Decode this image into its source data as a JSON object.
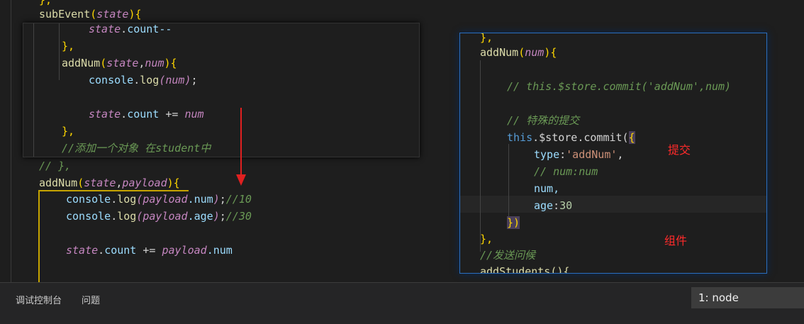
{
  "main_code": {
    "line_top": "},",
    "sub_event_name": "subEvent",
    "sub_event_param": "state",
    "line_close_comment": "// },",
    "add_num_name": "addNum",
    "add_num_params_state": "state",
    "add_num_params_payload": "payload",
    "log_payload_num": ".num",
    "log_comment_10": "//10",
    "log_payload_age": ".age",
    "log_comment_30": "//30",
    "state_count": "count",
    "payload_num": ".num"
  },
  "overlay_left": {
    "line1": "state.count--",
    "line2": "},",
    "line3_name": "addNum",
    "line3_params_state": "state",
    "line3_params_num": "num",
    "line4": "console.log(num);",
    "line5": "state.count += num",
    "line6": "},",
    "line7": "//添加一个对象 在student中"
  },
  "overlay_right": {
    "line1": "},",
    "line2_name": "addNum",
    "line2_param": "num",
    "line3": "// this.$store.commit('addNum',num)",
    "line4": "// 特殊的提交",
    "line5_this": "this",
    "line5_rest": ".$store.commit(",
    "line6_key": "type",
    "line6_val": "'addNum'",
    "line7": "// num:num",
    "line8": "num,",
    "line9_key": "age",
    "line9_val": "30",
    "line10": "})",
    "line11": "},",
    "line12": "//发送问候",
    "line13": "addStudents(){"
  },
  "annotations": {
    "commit": "提交",
    "component": "组件"
  },
  "panel": {
    "tab_debug_console": "调试控制台",
    "tab_problems": "问题",
    "terminal_select": "1: node"
  }
}
